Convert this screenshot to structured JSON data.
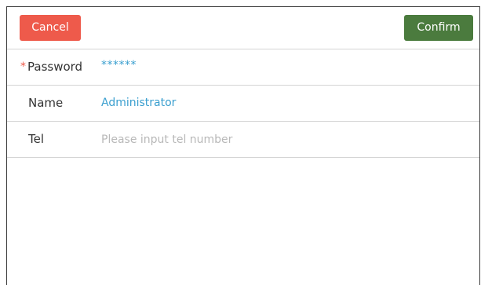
{
  "header": {
    "cancel_label": "Cancel",
    "confirm_label": "Confirm"
  },
  "form": {
    "password": {
      "required_mark": "*",
      "label": "Password",
      "value": "******"
    },
    "name": {
      "label": "Name",
      "value": "Administrator"
    },
    "tel": {
      "label": "Tel",
      "value": "",
      "placeholder": "Please input tel number"
    }
  },
  "colors": {
    "cancel": "#ee5a4b",
    "confirm": "#4b7b3e",
    "value_text": "#3a9fcf",
    "placeholder": "#b8b8b8"
  }
}
